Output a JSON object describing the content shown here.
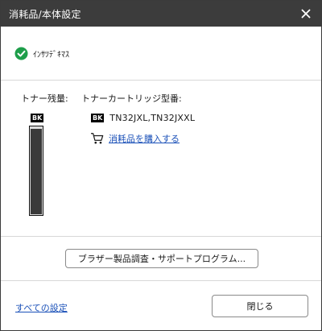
{
  "window": {
    "title": "消耗品/本体設定",
    "titlebar_color": "#3c3c3c"
  },
  "status": {
    "icon": "check-circle-icon",
    "icon_color": "#1e9e4a",
    "text": "ｲﾝｻﾂﾃﾞｷﾏｽ"
  },
  "toner": {
    "label": "トナー残量:",
    "badge": "BK",
    "level_fraction": 0.98
  },
  "cartridge": {
    "label": "トナーカートリッジ型番:",
    "badge": "BK",
    "model": "TN32JXL,TN32JXXL",
    "buy_link": "消耗品を購入する",
    "buy_icon": "cart-icon"
  },
  "buttons": {
    "support": "ブラザー製品調査・サポートプログラム...",
    "close": "閉じる"
  },
  "links": {
    "all_settings": "すべての設定",
    "link_color": "#1a50b8"
  }
}
